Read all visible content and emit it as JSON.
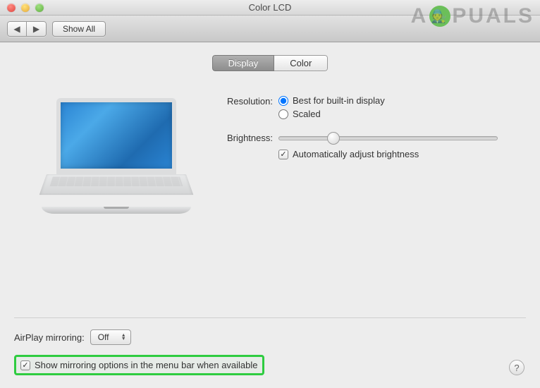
{
  "window": {
    "title": "Color LCD"
  },
  "toolbar": {
    "show_all": "Show All"
  },
  "tabs": {
    "display": "Display",
    "color": "Color"
  },
  "settings": {
    "resolution_label": "Resolution:",
    "resolution_best": "Best for built-in display",
    "resolution_scaled": "Scaled",
    "brightness_label": "Brightness:",
    "auto_brightness": "Automatically adjust brightness"
  },
  "airplay": {
    "label": "AirPlay mirroring:",
    "value": "Off"
  },
  "mirror_checkbox": "Show mirroring options in the menu bar when available",
  "watermark": {
    "left": "A",
    "right": "PUALS"
  }
}
